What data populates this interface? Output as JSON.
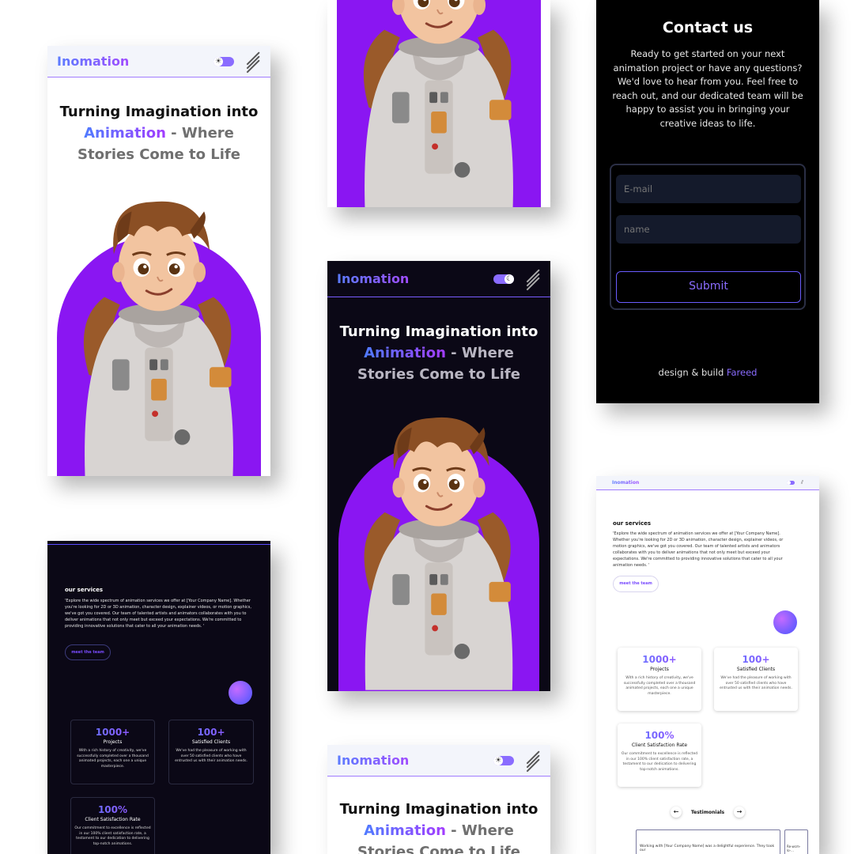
{
  "brand": "Inomation",
  "hero": {
    "line1": "Turning Imagination into",
    "highlight": "Animation",
    "dash": " -  Where",
    "line3": "Stories Come to Life"
  },
  "contact": {
    "title": "Contact us",
    "body": "Ready to get started on your next animation project or have any questions? We'd love to hear from you. Feel free to reach out, and our dedicated team will be happy to assist you in bringing your creative ideas to life.",
    "email_placeholder": "E-mail",
    "name_placeholder": "name",
    "submit_label": "Submit",
    "footer_prefix": "design & build ",
    "footer_name": "Fareed"
  },
  "services": {
    "title": "our services",
    "body": "'Explore the wide spectrum of animation services we offer at [Your Company Name]. Whether you're looking for 2D or 3D animation, character design, explainer videos, or motion graphics, we've got you covered. Our team of talented artists and animators collaborates with you to deliver animations that not only meet but exceed your expectations. We're committed to providing innovative solutions that cater to all your animation needs. '",
    "button_label": "meet the team",
    "stats": [
      {
        "number": "1000+",
        "label": "Projects",
        "desc": "With a rich history of creativity, we've successfully completed over a thousand animated projects, each one a unique masterpiece."
      },
      {
        "number": "100+",
        "label": "Satisfied Clients",
        "desc": "We've had the pleasure of working with over 50 satisfied clients who have entrusted us with their animation needs."
      },
      {
        "number": "100%",
        "label": "Client Satisfaction Rate",
        "desc": "Our commitment to excellence is reflected in our 100% client satisfaction rate, a testament to our dedication to delivering top-notch animations."
      }
    ],
    "testimonials_label": "Testimonials",
    "testimonial_quote": "Working with [Your Company Name] was a delightful experience. They took our",
    "testimonial_quote_2": "Re-wcm-lo-..."
  },
  "colors": {
    "accent_blue": "#5b7cff",
    "accent_purple": "#a04cff",
    "blob_purple": "#8a16f2",
    "dark_bg": "#0b0816",
    "contact_bg": "#000000"
  },
  "icons": {
    "theme_light": "sun-icon",
    "theme_dark": "moon-icon",
    "menu": "diagonal-lines-icon",
    "prev": "arrow-left-icon",
    "next": "arrow-right-icon"
  }
}
